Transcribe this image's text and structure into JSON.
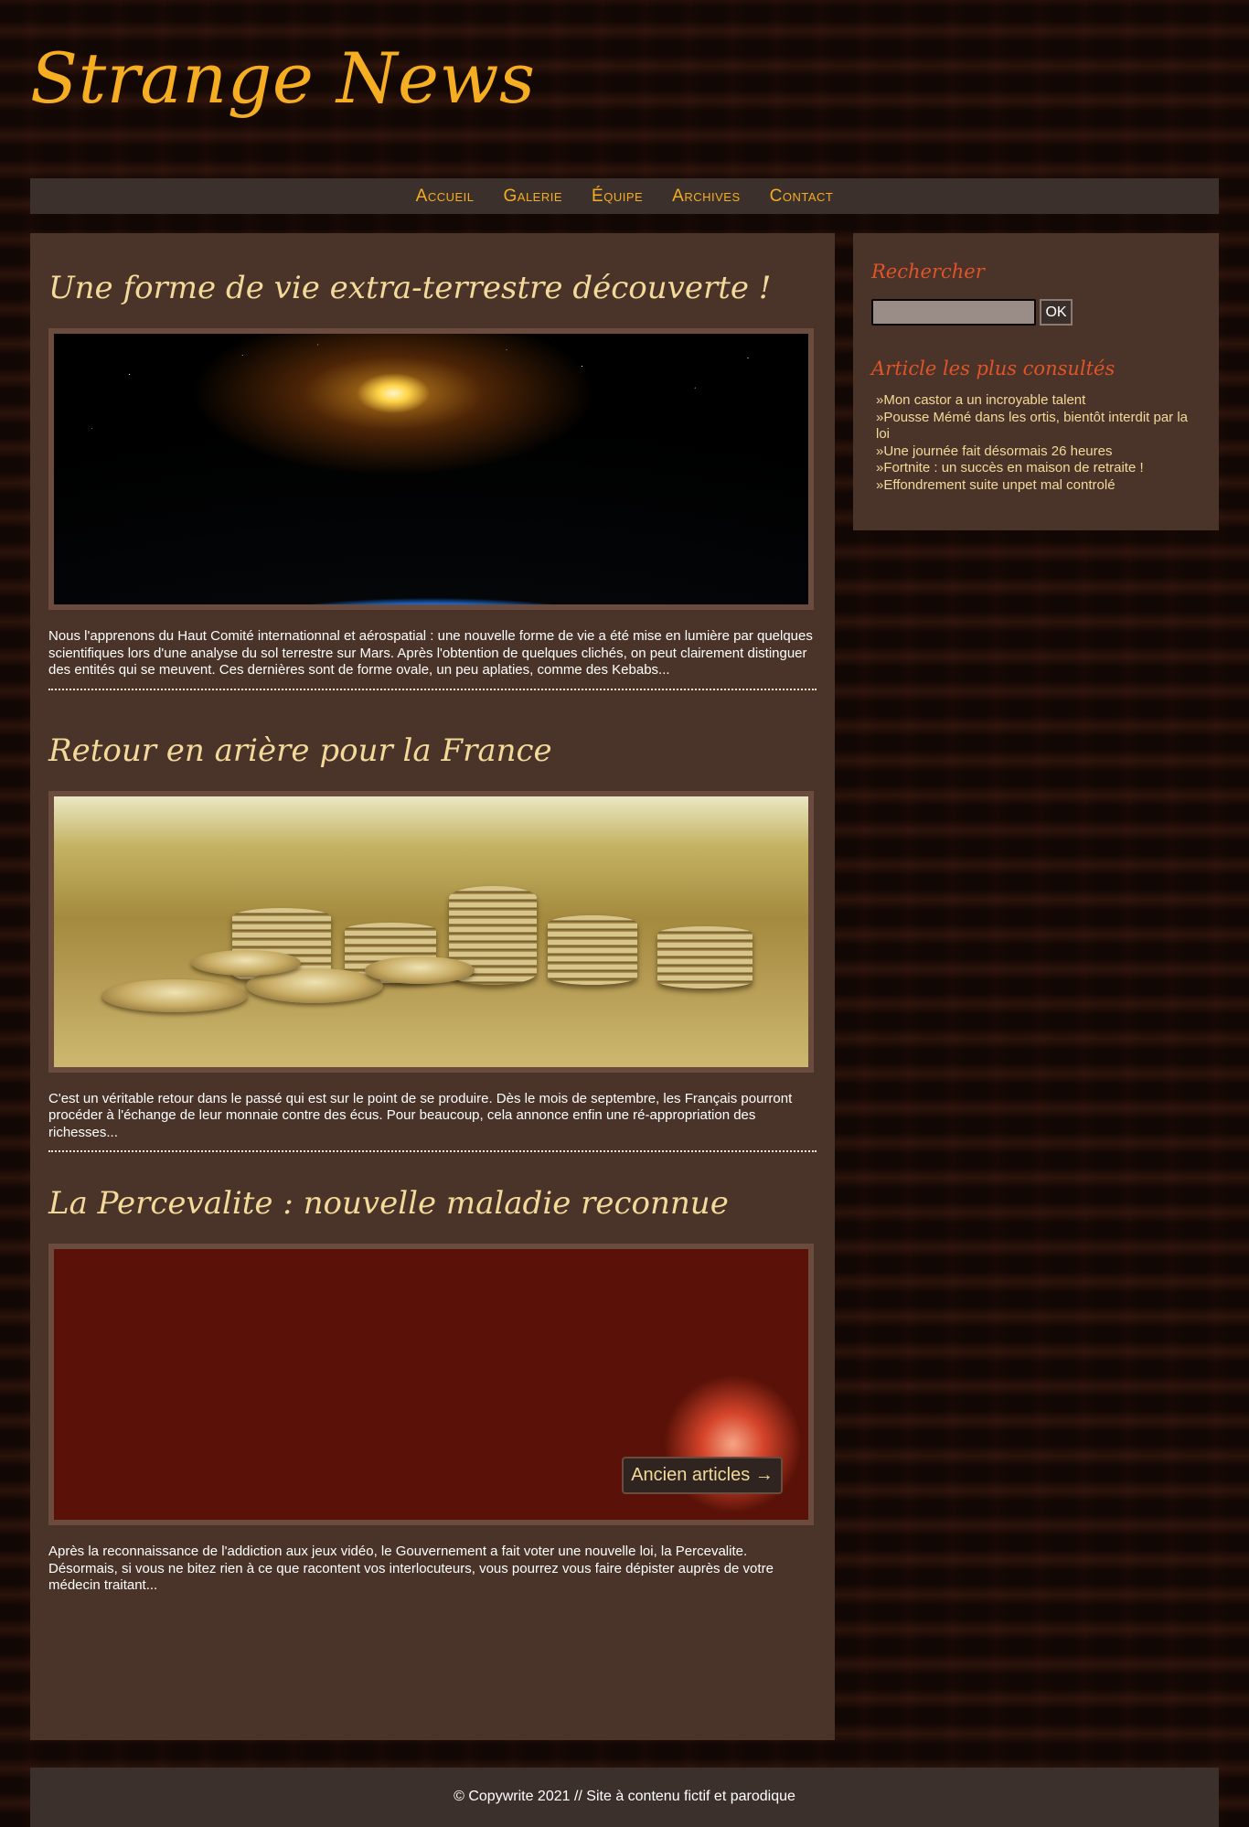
{
  "site": {
    "title": "Strange News"
  },
  "nav": {
    "items": [
      {
        "label": "Accueil"
      },
      {
        "label": "Galerie"
      },
      {
        "label": "Équipe"
      },
      {
        "label": "Archives"
      },
      {
        "label": "Contact"
      }
    ]
  },
  "articles": [
    {
      "title": "Une forme de vie extra-terrestre découverte !",
      "image": "earth-sunrise-image",
      "text": "Nous l'apprenons du Haut Comité internationnal et aérospatial : une nouvelle forme de vie a été mise en lumière par quelques scientifiques lors d'une analyse du sol terrestre sur Mars. Après l'obtention de quelques clichés, on peut clairement distinguer des entités qui se meuvent. Ces dernières sont de forme ovale, un peu aplaties, comme des Kebabs..."
    },
    {
      "title": "Retour en arière pour la France",
      "image": "coin-stacks-image",
      "text": "C'est un véritable retour dans le passé qui est sur le point de se produire. Dès le mois de septembre, les Français pourront procéder à l'échange de leur monnaie contre des écus. Pour beaucoup, cela annonce enfin une ré-appropriation des richesses..."
    },
    {
      "title": "La Percevalite : nouvelle maladie reconnue",
      "image": "virus-image",
      "text": "Après la reconnaissance de l'addiction aux jeux vidéo, le Gouvernement a fait voter une nouvelle loi, la Percevalite. Désormais, si vous ne bitez rien à ce que racontent vos interlocuteurs, vous pourrez vous faire dépister auprès de votre médecin traitant..."
    }
  ],
  "pagination": {
    "older_label": "Ancien articles →"
  },
  "sidebar": {
    "search_title": "Rechercher",
    "search_placeholder": "",
    "search_button": "OK",
    "popular_title": "Article les plus consultés",
    "popular": [
      "»Mon castor a un incroyable talent",
      "»Pousse Mémé dans les ortis, bientôt interdit par la loi",
      "»Une journée fait désormais 26 heures",
      "»Fortnite : un succès en maison de retraite !",
      "»Effondrement suite unpet mal controlé"
    ]
  },
  "footer": {
    "text": "© Copywrite 2021 // Site à contenu fictif et parodique"
  },
  "colors": {
    "title": "#f5ad22",
    "article_title": "#f3d99a",
    "sidebar_heading": "#e0542a",
    "panel": "#4a3328",
    "bar": "#3c302c"
  }
}
